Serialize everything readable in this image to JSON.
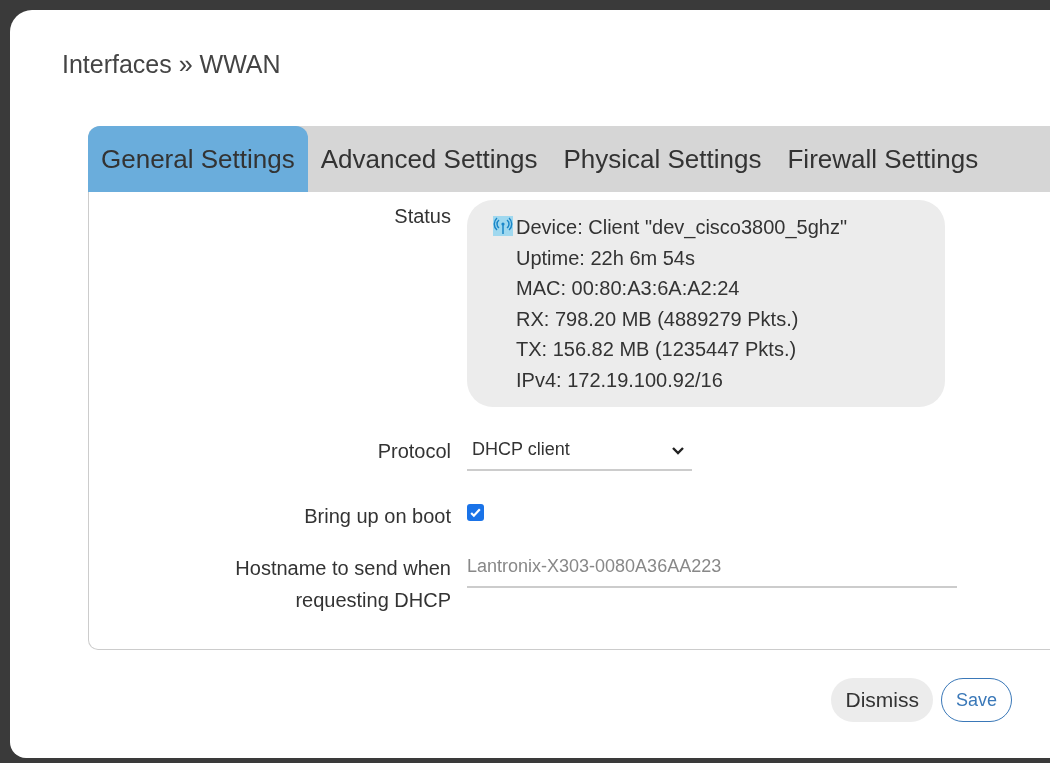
{
  "title": "Interfaces » WWAN",
  "tabs": [
    {
      "label": "General Settings",
      "selected": true
    },
    {
      "label": "Advanced Settings",
      "selected": false
    },
    {
      "label": "Physical Settings",
      "selected": false
    },
    {
      "label": "Firewall Settings",
      "selected": false
    }
  ],
  "status": {
    "label": "Status",
    "lines": [
      "Device: Client \"dev_cisco3800_5ghz\"",
      "Uptime: 22h 6m 54s",
      "MAC: 00:80:A3:6A:A2:24",
      "RX: 798.20 MB (4889279 Pkts.)",
      "TX: 156.82 MB (1235447 Pkts.)",
      "IPv4: 172.19.100.92/16"
    ]
  },
  "protocol": {
    "label": "Protocol",
    "value": "DHCP client"
  },
  "boot": {
    "label": "Bring up on boot",
    "checked": true
  },
  "hostname": {
    "label": "Hostname to send when requesting DHCP",
    "placeholder": "Lantronix-X303-0080A36AA223"
  },
  "buttons": [
    {
      "label": "Dismiss",
      "kind": "neutral"
    },
    {
      "label": "Save",
      "kind": "primary"
    }
  ]
}
